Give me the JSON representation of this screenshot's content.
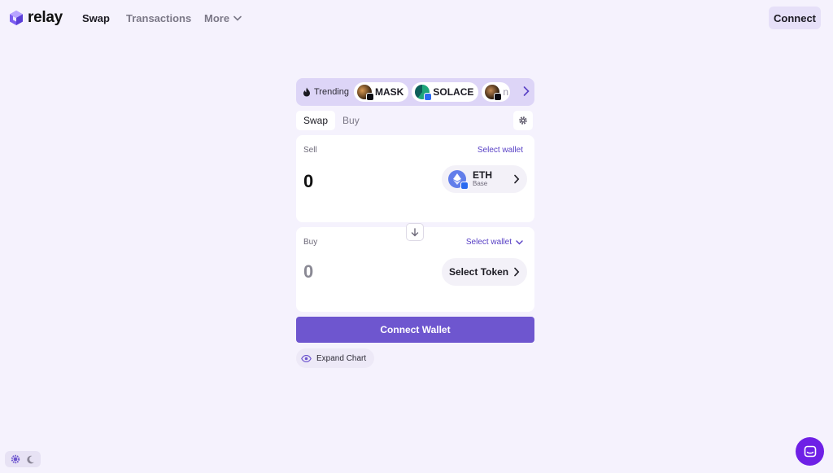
{
  "header": {
    "brand": "relay",
    "nav": {
      "swap": "Swap",
      "transactions": "Transactions",
      "more": "More"
    },
    "connect_label": "Connect"
  },
  "trending": {
    "label": "Trending",
    "tokens": [
      {
        "symbol": "MASK"
      },
      {
        "symbol": "SOLACE"
      },
      {
        "symbol": "n"
      }
    ]
  },
  "tabs": {
    "swap": "Swap",
    "buy": "Buy"
  },
  "sell": {
    "label": "Sell",
    "wallet_label": "Select wallet",
    "amount": "0",
    "token": {
      "symbol": "ETH",
      "chain": "Base"
    }
  },
  "buy": {
    "label": "Buy",
    "wallet_label": "Select wallet",
    "amount": "0",
    "token_button_label": "Select Token"
  },
  "connect_wallet_label": "Connect Wallet",
  "expand_chart_label": "Expand Chart",
  "colors": {
    "background": "#f5f2fd",
    "accent": "#6e56cf",
    "trending_bar": "#ddd5f7",
    "chat_button": "#6e20e6"
  }
}
